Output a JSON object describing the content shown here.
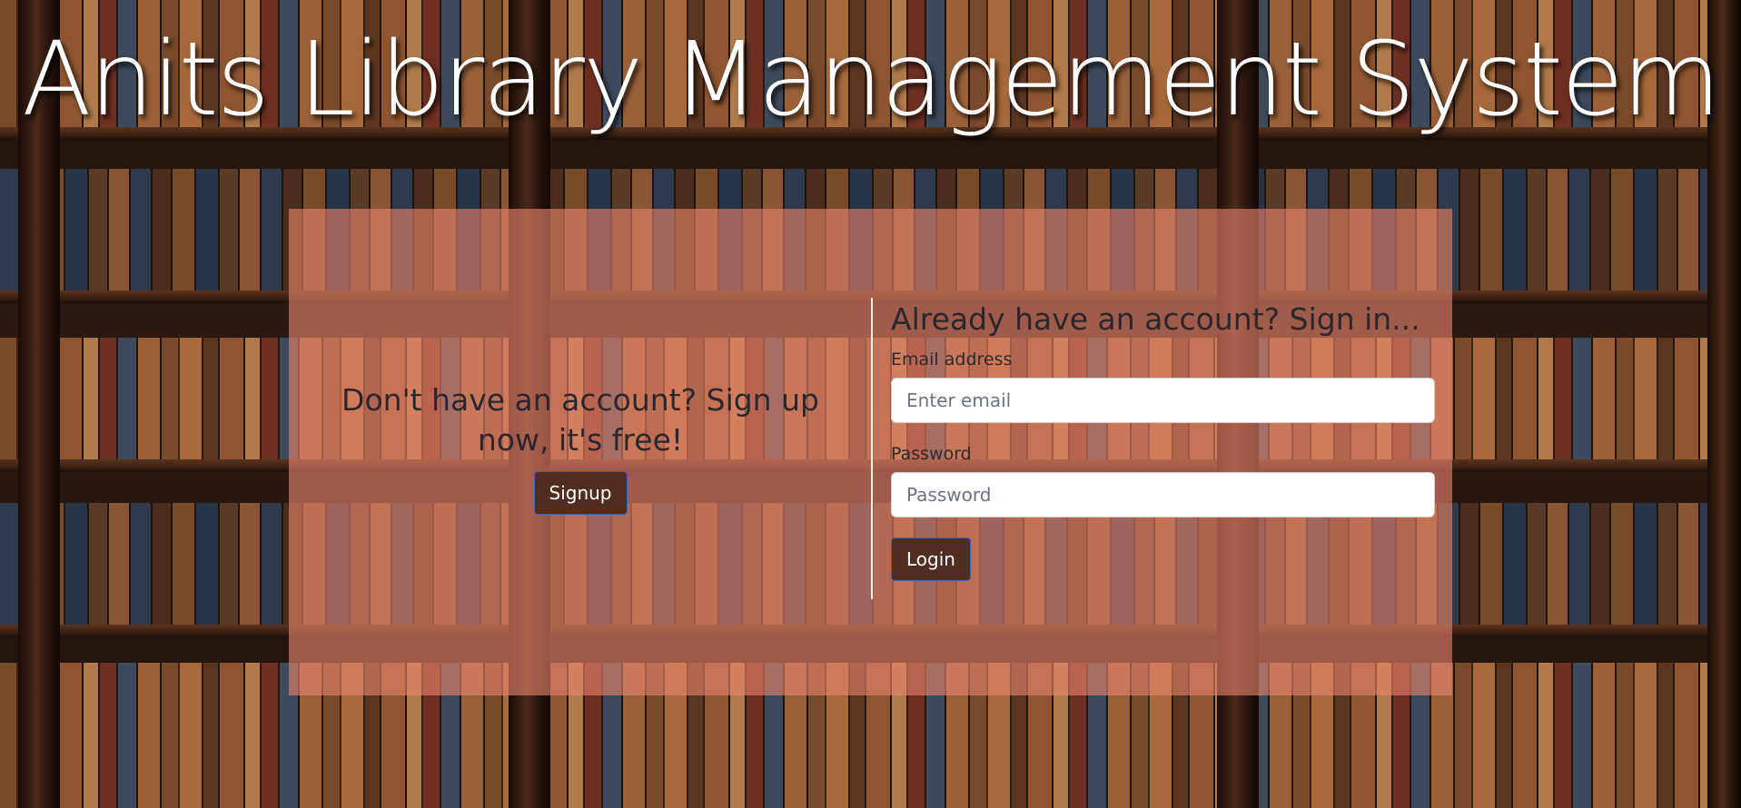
{
  "app": {
    "title": "Anits Library Management System"
  },
  "signup": {
    "heading": "Don't have an account? Sign up now, it's free!",
    "button_label": "Signup"
  },
  "signin": {
    "heading": "Already have an account? Sign in...",
    "email_label": "Email address",
    "email_placeholder": "Enter email",
    "email_value": "",
    "password_label": "Password",
    "password_placeholder": "Password",
    "password_value": "",
    "button_label": "Login"
  },
  "colors": {
    "card_overlay": "#e8846c",
    "button_bg": "#4f2e20",
    "button_border": "#3d63b8",
    "heading_text": "#2a2730",
    "title_text": "#ffffff"
  }
}
